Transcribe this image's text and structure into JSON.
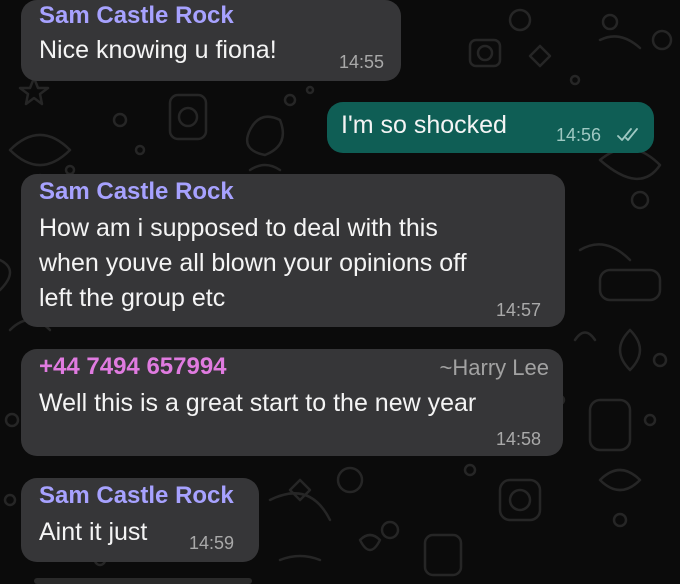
{
  "colors": {
    "background": "#0b0b0b",
    "incoming_bubble": "#363638",
    "outgoing_bubble": "#0f5e55",
    "sender_name": "#a7a2ff",
    "unknown_sender": "#e07be0",
    "read_ticks": "#9ec8c2"
  },
  "messages": [
    {
      "direction": "incoming",
      "sender": "Sam Castle Rock",
      "lines": [
        "Nice knowing u fiona!"
      ],
      "time": "14:55"
    },
    {
      "direction": "outgoing",
      "lines": [
        "I'm so shocked"
      ],
      "time": "14:56",
      "status_icon": "double-tick-icon"
    },
    {
      "direction": "incoming",
      "sender": "Sam Castle Rock",
      "lines": [
        "How am i supposed to deal with this",
        "when youve all blown your opinions off",
        "left the group etc"
      ],
      "time": "14:57"
    },
    {
      "direction": "incoming",
      "sender": "+44 7494 657994",
      "alias": "~Harry Lee",
      "lines": [
        "Well this is a great start to the new year"
      ],
      "time": "14:58"
    },
    {
      "direction": "incoming",
      "sender": "Sam Castle Rock",
      "lines": [
        "Aint it just"
      ],
      "time": "14:59"
    }
  ]
}
